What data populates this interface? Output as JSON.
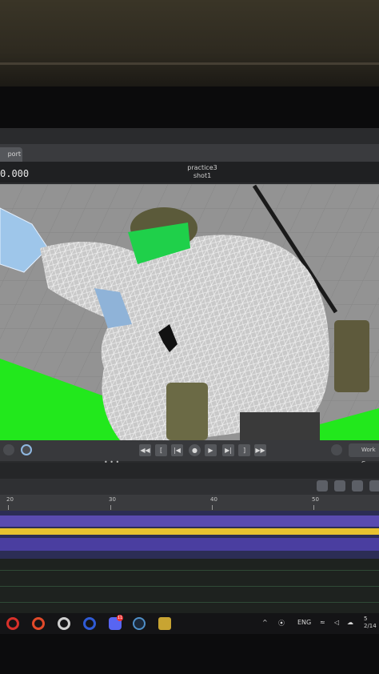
{
  "editor": {
    "tab_label": "port",
    "timecode": "0.000",
    "sequence_name": "practice3",
    "shot_name": "shot1"
  },
  "transport": {
    "buttons": [
      "◀◀",
      "[",
      "|◀",
      "●",
      "▶",
      "▶|",
      "]",
      "▶▶"
    ],
    "work_button_label": "Work C"
  },
  "timeline": {
    "ruler_labels": [
      "20",
      "30",
      "40",
      "50"
    ],
    "tracks": [
      {
        "color": "#5a4bb0"
      },
      {
        "color": "#e8c22f"
      },
      {
        "color": "#4a3ea0"
      }
    ]
  },
  "taskbar": {
    "apps": [
      "opera-gx",
      "opera",
      "obs",
      "opera-blue",
      "discord",
      "steam",
      "game"
    ],
    "discord_badge": "11",
    "language": "ENG",
    "time": "5",
    "date": "2/14"
  },
  "colors": {
    "greenscreen": "#22e81c",
    "accent_yellow": "#e8c22f",
    "track_purple": "#4f46a8"
  }
}
